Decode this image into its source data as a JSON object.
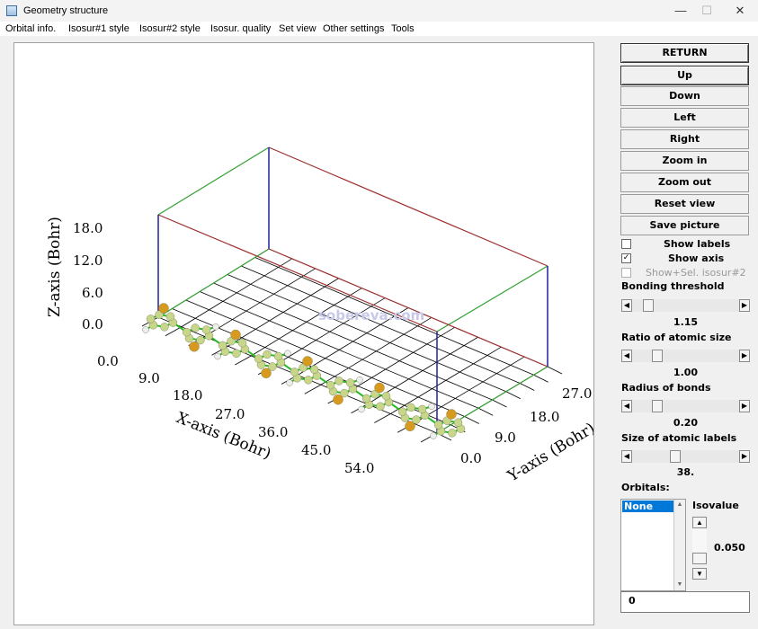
{
  "window": {
    "title": "Geometry structure",
    "minimize_glyph": "—",
    "maximize_glyph": "☐",
    "close_glyph": "✕"
  },
  "menu": [
    "Orbital info.",
    "Isosur#1 style",
    "Isosur#2 style",
    "Isosur. quality",
    "Set view",
    "Other settings",
    "Tools"
  ],
  "plot": {
    "z_axis_label": "Z-axis (Bohr)",
    "x_axis_label": "X-axis (Bohr)",
    "y_axis_label": "Y-axis (Bohr)",
    "z_ticks": [
      "18.0",
      "12.0",
      "6.0",
      "0.0"
    ],
    "x_ticks": [
      "0.0",
      "9.0",
      "18.0",
      "27.0",
      "36.0",
      "45.0",
      "54.0"
    ],
    "y_ticks": [
      "27.0",
      "18.0",
      "9.0",
      "0.0"
    ],
    "watermark": "sobereva.com",
    "colors": {
      "carbon": "#c8d68a",
      "sulfur": "#d79a1c",
      "hydrogen": "#eeeeee",
      "bond": "#22bb22",
      "box_red": "#a03030",
      "box_green": "#30a030",
      "box_blue": "#2020a0",
      "grid": "#000000"
    }
  },
  "buttons": {
    "return": "RETURN",
    "up": "Up",
    "down": "Down",
    "left": "Left",
    "right": "Right",
    "zoom_in": "Zoom in",
    "zoom_out": "Zoom out",
    "reset_view": "Reset view",
    "save_picture": "Save picture"
  },
  "checkboxes": {
    "show_labels": {
      "label": "Show labels",
      "checked": false
    },
    "show_axis": {
      "label": "Show axis",
      "checked": true
    },
    "show_sel_isosur2": {
      "label": "Show+Sel. isosur#2",
      "checked": false,
      "enabled": false
    }
  },
  "sliders": {
    "bonding_threshold": {
      "label": "Bonding threshold",
      "value": "1.15"
    },
    "ratio_atomic_size": {
      "label": "Ratio of atomic size",
      "value": "1.00"
    },
    "radius_bonds": {
      "label": "Radius of bonds",
      "value": "0.20"
    },
    "size_atomic_labels": {
      "label": "Size of atomic labels",
      "value": "38."
    }
  },
  "orbitals": {
    "label": "Orbitals:",
    "selected": "None",
    "isovalue_label": "Isovalue",
    "isovalue": "0.050",
    "orbital_index": "0"
  }
}
